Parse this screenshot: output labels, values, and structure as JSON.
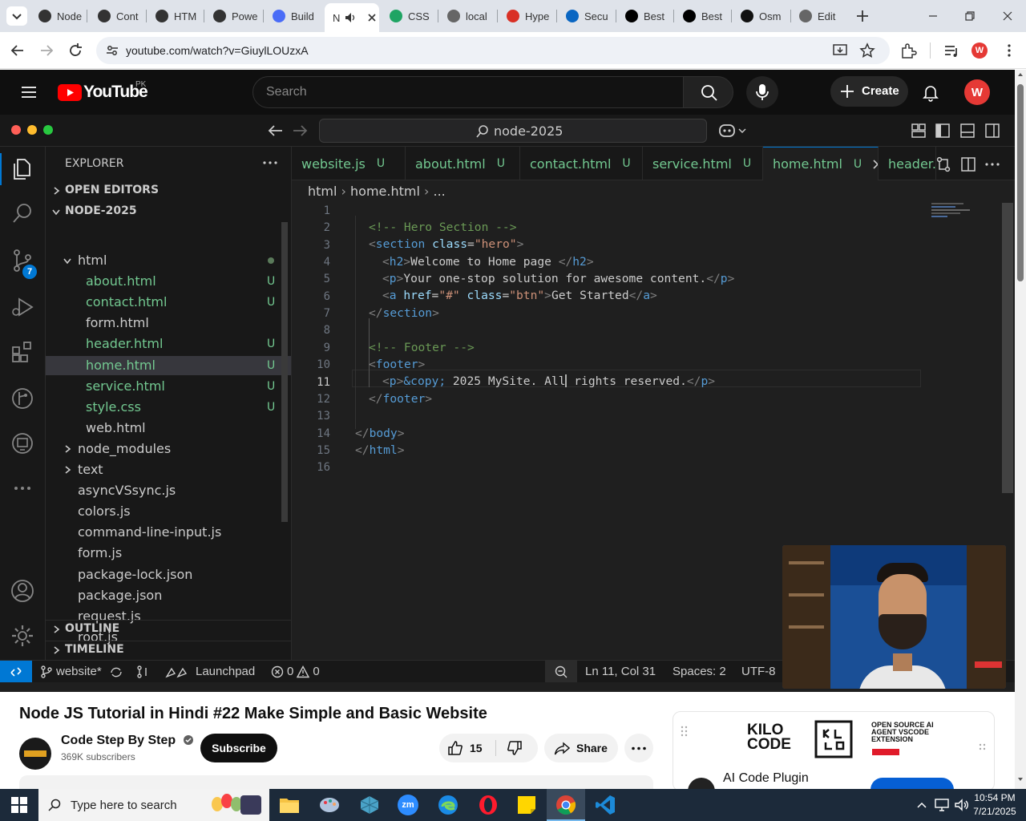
{
  "browser": {
    "tabs": [
      {
        "label": "Node",
        "fav": "#333"
      },
      {
        "label": "Cont",
        "fav": "#333"
      },
      {
        "label": "HTM",
        "fav": "#333"
      },
      {
        "label": "Powe",
        "fav": "#333"
      },
      {
        "label": "Build",
        "fav": "#4a6cf7"
      },
      {
        "label": "N",
        "fav": "",
        "active": true
      },
      {
        "label": "CSS",
        "fav": "#1fa463"
      },
      {
        "label": "local",
        "fav": "#666"
      },
      {
        "label": "Hype",
        "fav": "#d93025"
      },
      {
        "label": "Secu",
        "fav": "#0a66c2"
      },
      {
        "label": "Best",
        "fav": "#000"
      },
      {
        "label": "Best",
        "fav": "#000"
      },
      {
        "label": "Osm",
        "fav": "#111"
      },
      {
        "label": "Edit",
        "fav": "#666"
      }
    ],
    "url": "youtube.com/watch?v=GiuylLOUzxA",
    "profile_initial": "W"
  },
  "youtube": {
    "logo_text": "YouTube",
    "region": "PK",
    "search_placeholder": "Search",
    "create_label": "Create",
    "avatar_initial": "W",
    "video_title": "Node JS Tutorial in Hindi #22 Make Simple and Basic Website",
    "channel_name": "Code Step By Step",
    "subscribers": "369K subscribers",
    "subscribe_label": "Subscribe",
    "likes": "15",
    "share_label": "Share",
    "ad": {
      "brand": "KILO CODE",
      "tagline": "OPEN SOURCE AI AGENT VSCODE EXTENSION",
      "title": "AI Code Plugin"
    }
  },
  "vscode": {
    "search": "node-2025",
    "explorer_title": "EXPLORER",
    "open_editors": "OPEN EDITORS",
    "project": "NODE-2025",
    "tree": [
      {
        "label": "html",
        "type": "folder",
        "indent": 1,
        "open": true,
        "dot": true
      },
      {
        "label": "about.html",
        "indent": 2,
        "mod": true
      },
      {
        "label": "contact.html",
        "indent": 2,
        "mod": true
      },
      {
        "label": "form.html",
        "indent": 2,
        "mod": false
      },
      {
        "label": "header.html",
        "indent": 2,
        "mod": true
      },
      {
        "label": "home.html",
        "indent": 2,
        "mod": true,
        "selected": true
      },
      {
        "label": "service.html",
        "indent": 2,
        "mod": true
      },
      {
        "label": "style.css",
        "indent": 2,
        "mod": true
      },
      {
        "label": "web.html",
        "indent": 2,
        "mod": false
      },
      {
        "label": "node_modules",
        "type": "folder",
        "indent": 1,
        "open": false
      },
      {
        "label": "text",
        "type": "folder",
        "indent": 1,
        "open": false
      },
      {
        "label": "asyncVSsync.js",
        "indent": 1
      },
      {
        "label": "colors.js",
        "indent": 1
      },
      {
        "label": "command-line-input.js",
        "indent": 1
      },
      {
        "label": "form.js",
        "indent": 1
      },
      {
        "label": "package-lock.json",
        "indent": 1
      },
      {
        "label": "package.json",
        "indent": 1
      },
      {
        "label": "request.js",
        "indent": 1
      },
      {
        "label": "root.js",
        "indent": 1
      }
    ],
    "outline": "OUTLINE",
    "timeline": "TIMELINE",
    "tabs": [
      {
        "label": "website.js",
        "status": "U"
      },
      {
        "label": "about.html",
        "status": "U"
      },
      {
        "label": "contact.html",
        "status": "U"
      },
      {
        "label": "service.html",
        "status": "U"
      },
      {
        "label": "home.html",
        "status": "U",
        "active": true
      },
      {
        "label": "header.",
        "status": ""
      }
    ],
    "breadcrumb": [
      "html",
      "home.html",
      "..."
    ],
    "scm_badge": "7",
    "line_numbers": [
      "1",
      "2",
      "3",
      "4",
      "5",
      "6",
      "7",
      "8",
      "9",
      "10",
      "11",
      "12",
      "13",
      "14",
      "15",
      "16"
    ],
    "status": {
      "branch": "website*",
      "launchpad": "Launchpad",
      "errors": "0",
      "warnings": "0",
      "position": "Ln 11, Col 31",
      "spaces": "Spaces: 2",
      "encoding": "UTF-8"
    }
  },
  "taskbar": {
    "search_placeholder": "Type here to search",
    "time": "10:54 PM",
    "date": "7/21/2025"
  },
  "colors": {
    "vscode_bg": "#1f1f1f",
    "vscode_panel": "#181818",
    "git_modified": "#73c991",
    "yt_red": "#ff0000",
    "yt_header": "#0f0f0f",
    "taskbar": "#1c2a3a"
  }
}
